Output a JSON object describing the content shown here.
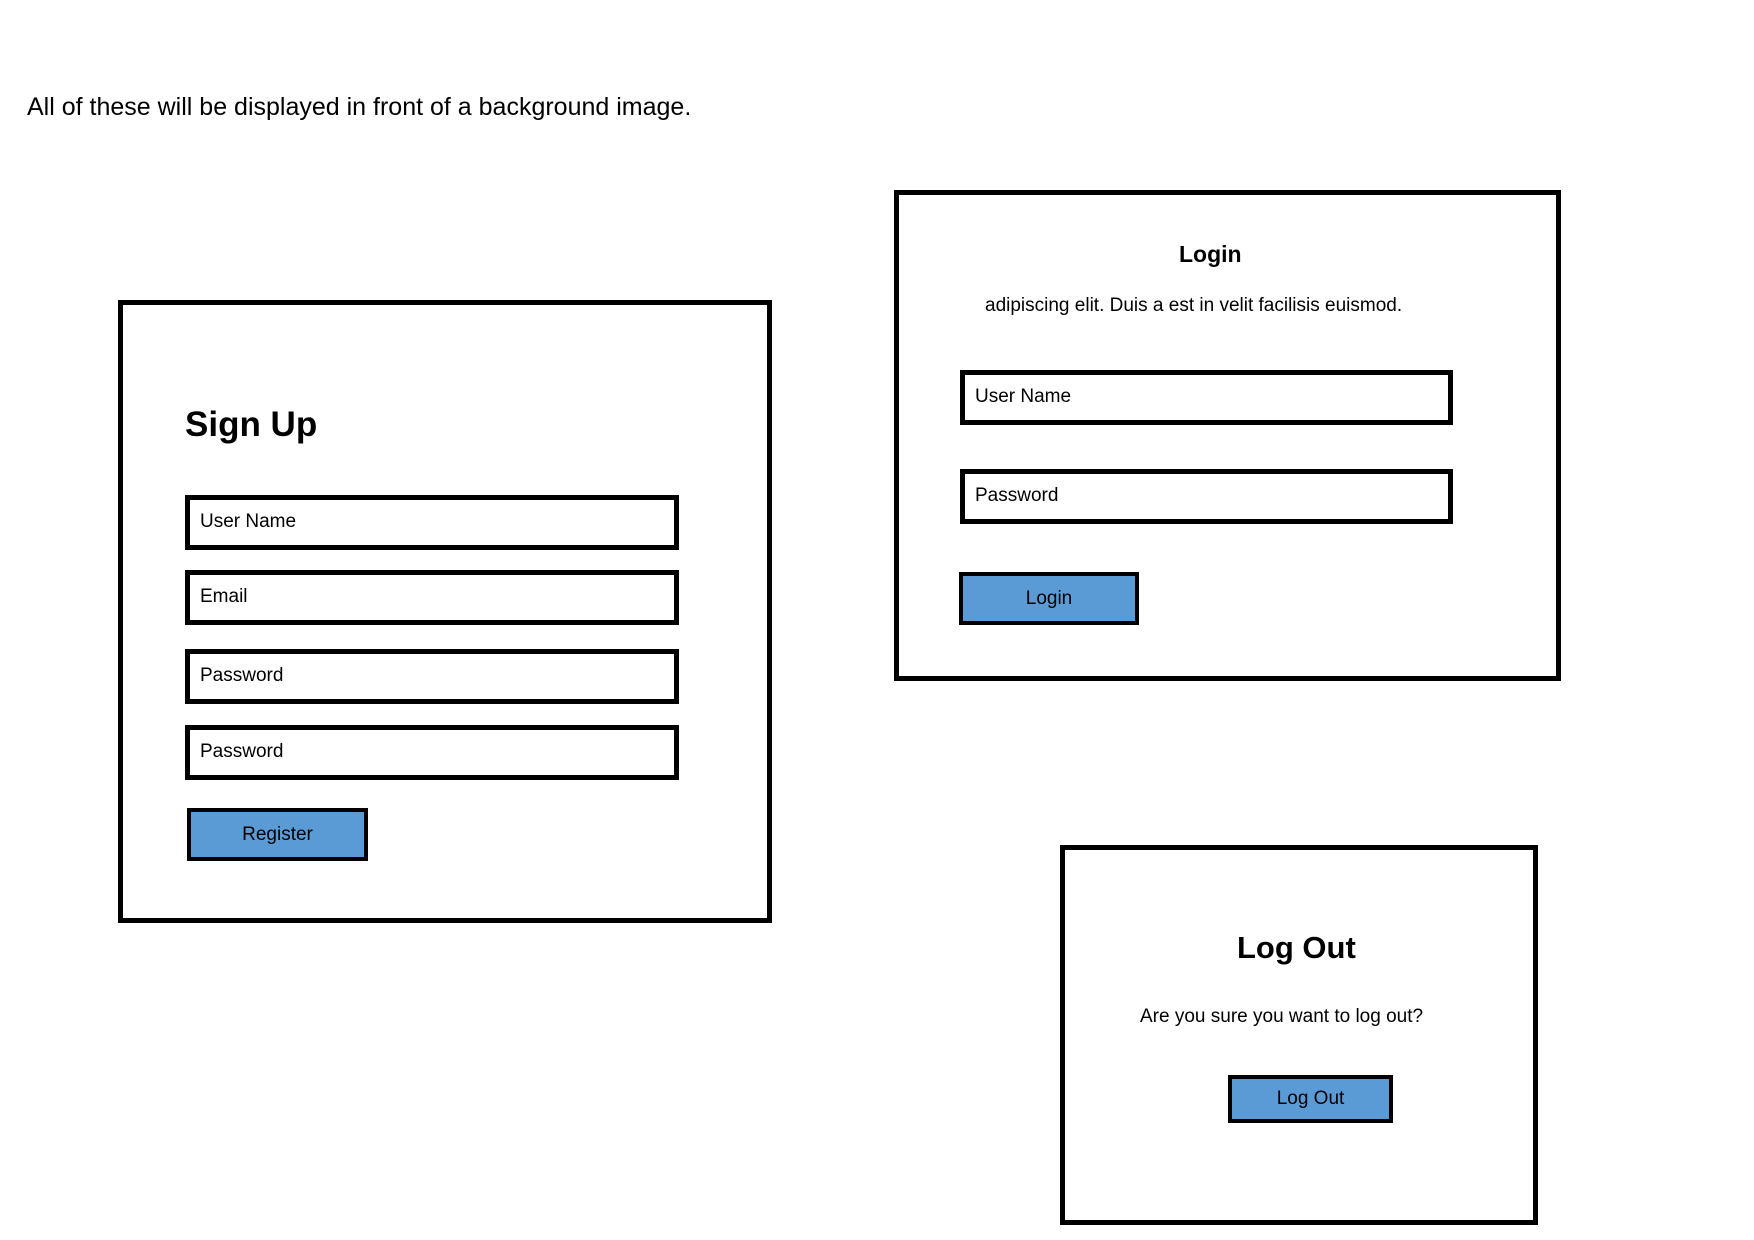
{
  "note": "All of these will be displayed in front of a background image.",
  "accent_color": "#5b9bd5",
  "signup": {
    "title": "Sign Up",
    "fields": [
      "User Name",
      "Email",
      "Password",
      "Password"
    ],
    "button": "Register"
  },
  "login": {
    "title": "Login",
    "subtitle": "adipiscing elit. Duis a est in velit facilisis euismod.",
    "fields": [
      "User Name",
      "Password"
    ],
    "button": "Login"
  },
  "logout": {
    "title": "Log Out",
    "message": "Are you sure you want to log out?",
    "button": "Log Out"
  }
}
